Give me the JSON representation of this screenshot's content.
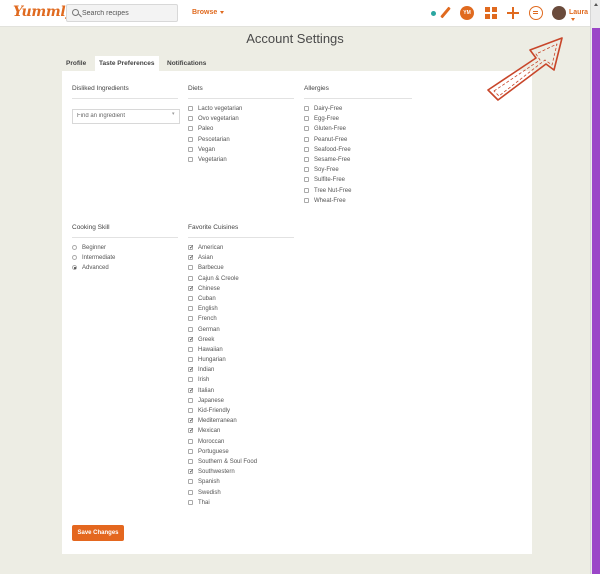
{
  "header": {
    "logo": "Yummly",
    "logo_tm": "TM",
    "search_placeholder": "Search recipes",
    "browse_label": "Browse",
    "ym_badge": "YM",
    "user_name": "Laura"
  },
  "page": {
    "title": "Account Settings"
  },
  "tabs": [
    {
      "label": "Profile"
    },
    {
      "label": "Taste Preferences"
    },
    {
      "label": "Notifications"
    }
  ],
  "disliked": {
    "heading": "Disliked Ingredients",
    "placeholder": "Find an ingredient"
  },
  "diets": {
    "heading": "Diets",
    "items": [
      "Lacto vegetarian",
      "Ovo vegetarian",
      "Paleo",
      "Pescetarian",
      "Vegan",
      "Vegetarian"
    ]
  },
  "allergies": {
    "heading": "Allergies",
    "items": [
      "Dairy-Free",
      "Egg-Free",
      "Gluten-Free",
      "Peanut-Free",
      "Seafood-Free",
      "Sesame-Free",
      "Soy-Free",
      "Sulfite-Free",
      "Tree Nut-Free",
      "Wheat-Free"
    ]
  },
  "skill": {
    "heading": "Cooking Skill",
    "options": [
      "Beginner",
      "Intermediate",
      "Advanced"
    ],
    "selected": "Advanced"
  },
  "cuisines": {
    "heading": "Favorite Cuisines",
    "items": [
      {
        "label": "American",
        "checked": true
      },
      {
        "label": "Asian",
        "checked": true
      },
      {
        "label": "Barbecue",
        "checked": false
      },
      {
        "label": "Cajun & Creole",
        "checked": false
      },
      {
        "label": "Chinese",
        "checked": true
      },
      {
        "label": "Cuban",
        "checked": false
      },
      {
        "label": "English",
        "checked": false
      },
      {
        "label": "French",
        "checked": false
      },
      {
        "label": "German",
        "checked": false
      },
      {
        "label": "Greek",
        "checked": true
      },
      {
        "label": "Hawaiian",
        "checked": false
      },
      {
        "label": "Hungarian",
        "checked": false
      },
      {
        "label": "Indian",
        "checked": true
      },
      {
        "label": "Irish",
        "checked": false
      },
      {
        "label": "Italian",
        "checked": true
      },
      {
        "label": "Japanese",
        "checked": false
      },
      {
        "label": "Kid-Friendly",
        "checked": false
      },
      {
        "label": "Mediterranean",
        "checked": true
      },
      {
        "label": "Mexican",
        "checked": true
      },
      {
        "label": "Moroccan",
        "checked": false
      },
      {
        "label": "Portuguese",
        "checked": false
      },
      {
        "label": "Southern & Soul Food",
        "checked": false
      },
      {
        "label": "Southwestern",
        "checked": true
      },
      {
        "label": "Spanish",
        "checked": false
      },
      {
        "label": "Swedish",
        "checked": false
      },
      {
        "label": "Thai",
        "checked": false
      }
    ]
  },
  "actions": {
    "save_label": "Save Changes"
  },
  "colors": {
    "brand": "#e06a1f",
    "page_bg": "#edede4",
    "scroll_accent": "#9b46c8"
  }
}
